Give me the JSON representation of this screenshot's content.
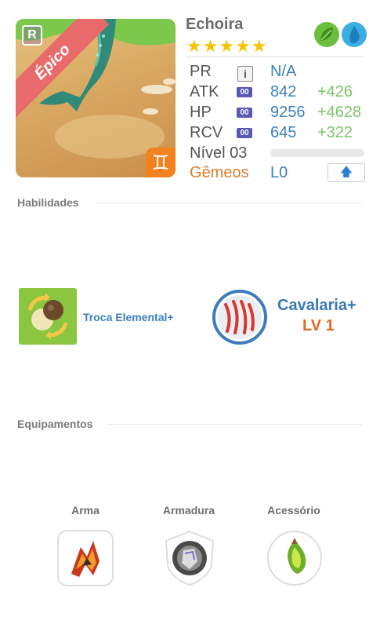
{
  "hero": {
    "name": "Echoira",
    "stars": "★★★★★",
    "rarity": "Épico",
    "rarity_badge": "R",
    "zodiac_icon": "gemini-icon",
    "elements": [
      "leaf-icon",
      "water-drop-icon"
    ]
  },
  "stats": {
    "pr_label": "PR",
    "pr_info": "i",
    "pr_value": "N/A",
    "atk_label": "ATK",
    "atk_badge": "00",
    "atk_value": "842",
    "atk_plus": "+426",
    "hp_label": "HP",
    "hp_badge": "00",
    "hp_value": "9256",
    "hp_plus": "+4628",
    "rcv_label": "RCV",
    "rcv_badge": "00",
    "rcv_value": "645",
    "rcv_plus": "+322",
    "level_label": "Nível 03",
    "level_progress": 0,
    "sign_label": "Gêmeos",
    "limit_value": "L0",
    "upgrade_icon": "arrow-up-icon"
  },
  "abilities": {
    "title": "Habilidades",
    "skill1_name": "Troca Elemental+",
    "skill2_name": "Cavalaria+",
    "skill2_level": "LV 1"
  },
  "equipment": {
    "title": "Equipamentos",
    "weapon_label": "Arma",
    "armor_label": "Armadura",
    "accessory_label": "Acessório"
  },
  "colors": {
    "accent_blue": "#3c7fbf",
    "bonus_green": "#7cc46b",
    "orange": "#e07b2a",
    "rarity_red": "#e86a6a",
    "star_yellow": "#f5c400"
  }
}
